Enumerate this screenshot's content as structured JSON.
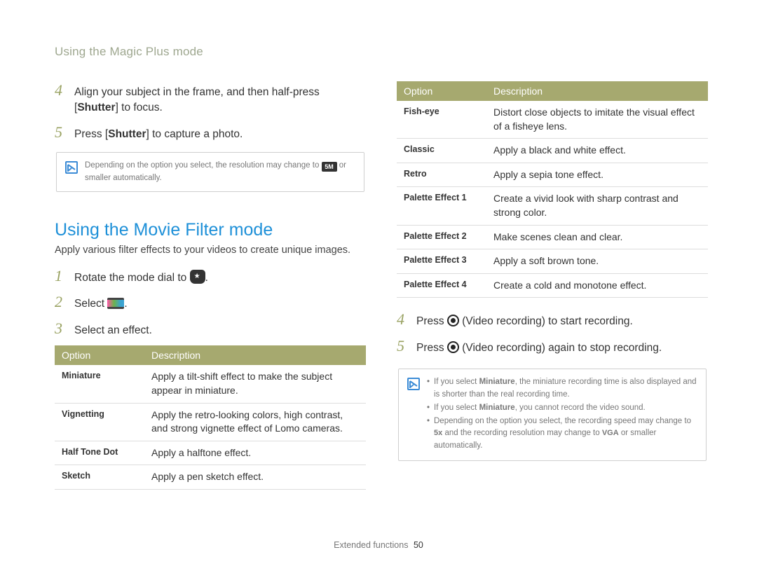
{
  "header": "Using the Magic Plus mode",
  "left": {
    "steps1": [
      {
        "num": "4",
        "pre": "Align your subject in the frame, and then half-press [",
        "bold": "Shutter",
        "post": "] to focus."
      },
      {
        "num": "5",
        "pre": "Press [",
        "bold": "Shutter",
        "post": "] to capture a photo."
      }
    ],
    "note1_pre": "Depending on the option you select, the resolution may change to ",
    "note1_badge": "5M",
    "note1_post": " or smaller automatically.",
    "section_title": "Using the Movie Filter mode",
    "section_intro": "Apply various filter effects to your videos to create unique images.",
    "steps2": [
      {
        "num": "1",
        "text": "Rotate the mode dial to ",
        "icon": "mode-dial",
        "tail": "."
      },
      {
        "num": "2",
        "text": "Select ",
        "icon": "film",
        "tail": "."
      },
      {
        "num": "3",
        "text": "Select an effect.",
        "icon": "",
        "tail": ""
      }
    ],
    "table_head": {
      "option": "Option",
      "desc": "Description"
    },
    "table_rows": [
      {
        "name": "Miniature",
        "desc": "Apply a tilt-shift effect to make the subject appear in miniature."
      },
      {
        "name": "Vignetting",
        "desc": "Apply the retro-looking colors, high contrast, and strong vignette effect of Lomo cameras."
      },
      {
        "name": "Half Tone Dot",
        "desc": "Apply a halftone effect."
      },
      {
        "name": "Sketch",
        "desc": "Apply a pen sketch effect."
      }
    ]
  },
  "right": {
    "table_head": {
      "option": "Option",
      "desc": "Description"
    },
    "table_rows": [
      {
        "name": "Fish-eye",
        "desc": "Distort close objects to imitate the visual effect of a fisheye lens."
      },
      {
        "name": "Classic",
        "desc": "Apply a black and white effect."
      },
      {
        "name": "Retro",
        "desc": "Apply a sepia tone effect."
      },
      {
        "name": "Palette Effect 1",
        "desc": "Create a vivid look with sharp contrast and strong color."
      },
      {
        "name": "Palette Effect 2",
        "desc": "Make scenes clean and clear."
      },
      {
        "name": "Palette Effect 3",
        "desc": "Apply a soft brown tone."
      },
      {
        "name": "Palette Effect 4",
        "desc": "Create a cold and monotone effect."
      }
    ],
    "steps": [
      {
        "num": "4",
        "pre": "Press ",
        "post": " (Video recording) to start recording."
      },
      {
        "num": "5",
        "pre": "Press ",
        "post": " (Video recording) again to stop recording."
      }
    ],
    "note2": {
      "li1_a": "If you select ",
      "li1_bold": "Miniature",
      "li1_b": ", the miniature recording time is also displayed and is shorter than the real recording time.",
      "li2_a": "If you select ",
      "li2_bold": "Miniature",
      "li2_b": ", you cannot record the video sound.",
      "li3_a": "Depending on the option you select, the recording speed may change to ",
      "li3_badge1": "5x",
      "li3_b": " and the recording resolution may change to ",
      "li3_badge2": "VGA",
      "li3_c": " or smaller automatically."
    }
  },
  "footer": {
    "label": "Extended functions",
    "page": "50"
  }
}
